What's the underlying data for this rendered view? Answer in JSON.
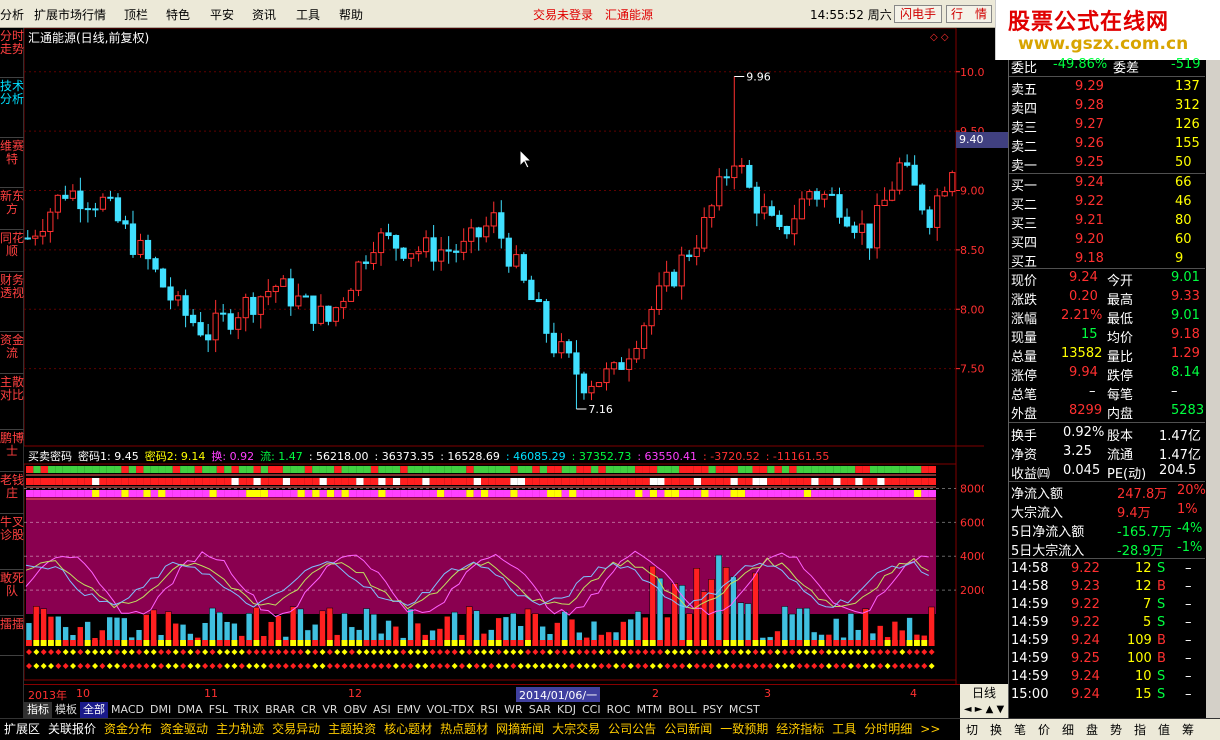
{
  "menu": {
    "items": [
      "分析",
      "扩展市场行情",
      "顶栏",
      "特色",
      "平安",
      "资讯",
      "工具",
      "帮助"
    ],
    "status1": "交易未登录",
    "status2": "汇通能源",
    "clock": "14:55:52 周六",
    "btn1": "闪电手",
    "btn2": "行　情"
  },
  "logo": {
    "main": "股票公式在线网",
    "url": "www.gszx.com.cn"
  },
  "left_tabs": [
    "分时走势",
    "技术分析",
    "维赛特",
    "新东方",
    "同花顺",
    "财务透视",
    "资金流",
    "主散对比",
    "鹏博士",
    "老钱庄",
    "牛叉诊股",
    "敢死队",
    "擂擂"
  ],
  "chart": {
    "title": "汇通能源(日线,前复权)",
    "high_label": "9.96",
    "low_label": "7.16",
    "current_tag": "9.40",
    "price_axis": [
      "10.00",
      "9.50",
      "9.00",
      "8.50",
      "8.00",
      "7.50"
    ],
    "vol_axis": [
      "80000",
      "60000",
      "40000",
      "20000"
    ]
  },
  "indicator": {
    "name": "买卖密码",
    "items": [
      {
        "t": "密码1: 9.45",
        "c": "#ffffff"
      },
      {
        "t": "密码2: 9.14",
        "c": "#ffff00"
      },
      {
        "t": "换: 0.92",
        "c": "#ff40ff"
      },
      {
        "t": "流: 1.47",
        "c": "#00ff40"
      },
      {
        "t": ": 56218.00",
        "c": "#ffffff"
      },
      {
        "t": ": 36373.35",
        "c": "#ffffff"
      },
      {
        "t": ": 16528.69",
        "c": "#ffffff"
      },
      {
        "t": ": 46085.29",
        "c": "#00e0ff"
      },
      {
        "t": ": 37352.73",
        "c": "#00ff40"
      },
      {
        "t": ": 63550.41",
        "c": "#ff40ff"
      },
      {
        "t": ": -3720.52",
        "c": "#ff3030"
      },
      {
        "t": ": -11161.55",
        "c": "#ff3030"
      }
    ]
  },
  "time_axis": {
    "items": [
      "2013年",
      "10",
      "11",
      "12",
      "2014/01/06/一",
      "2",
      "3",
      "4"
    ],
    "period": "日线"
  },
  "indicator_tabs": [
    "指标",
    "模板",
    "全部",
    "MACD",
    "DMI",
    "DMA",
    "FSL",
    "TRIX",
    "BRAR",
    "CR",
    "VR",
    "OBV",
    "ASI",
    "EMV",
    "VOL-TDX",
    "RSI",
    "WR",
    "SAR",
    "KDJ",
    "CCI",
    "ROC",
    "MTM",
    "BOLL",
    "PSY",
    "MCST"
  ],
  "bottom_tabs": [
    "扩展区",
    "关联报价",
    "资金分布",
    "资金驱动",
    "主力轨迹",
    "交易异动",
    "主题投资",
    "核心题材",
    "热点题材",
    "网摘新闻",
    "大宗交易",
    "公司公告",
    "公司新闻",
    "一致预期",
    "经济指标",
    "工具",
    "分时明细",
    ">>"
  ],
  "bottom_right": [
    "切",
    "换",
    "笔",
    "价",
    "细",
    "盘",
    "势",
    "指",
    "值",
    "筹"
  ],
  "quote": {
    "weibi": {
      "label": "委比",
      "value": "-49.86%",
      "label2": "委差",
      "value2": "-519"
    },
    "asks": [
      {
        "label": "卖五",
        "price": "9.29",
        "vol": "137"
      },
      {
        "label": "卖四",
        "price": "9.28",
        "vol": "312"
      },
      {
        "label": "卖三",
        "price": "9.27",
        "vol": "126"
      },
      {
        "label": "卖二",
        "price": "9.26",
        "vol": "155"
      },
      {
        "label": "卖一",
        "price": "9.25",
        "vol": "50"
      }
    ],
    "bids": [
      {
        "label": "买一",
        "price": "9.24",
        "vol": "66"
      },
      {
        "label": "买二",
        "price": "9.22",
        "vol": "46"
      },
      {
        "label": "买三",
        "price": "9.21",
        "vol": "80"
      },
      {
        "label": "买四",
        "price": "9.20",
        "vol": "60"
      },
      {
        "label": "买五",
        "price": "9.18",
        "vol": "9"
      }
    ],
    "stats": [
      {
        "l1": "现价",
        "v1": "9.24",
        "c1": "red",
        "l2": "今开",
        "v2": "9.01",
        "c2": "grn"
      },
      {
        "l1": "涨跌",
        "v1": "0.20",
        "c1": "red",
        "l2": "最高",
        "v2": "9.33",
        "c2": "red"
      },
      {
        "l1": "涨幅",
        "v1": "2.21%",
        "c1": "red",
        "l2": "最低",
        "v2": "9.01",
        "c2": "grn"
      },
      {
        "l1": "现量",
        "v1": "15",
        "c1": "grn",
        "l2": "均价",
        "v2": "9.18",
        "c2": "red"
      },
      {
        "l1": "总量",
        "v1": "13582",
        "c1": "yel",
        "l2": "量比",
        "v2": "1.29",
        "c2": "red"
      },
      {
        "l1": "涨停",
        "v1": "9.94",
        "c1": "red",
        "l2": "跌停",
        "v2": "8.14",
        "c2": "grn"
      },
      {
        "l1": "总笔",
        "v1": "–",
        "c1": "wht",
        "l2": "每笔",
        "v2": "–",
        "c2": "wht"
      },
      {
        "l1": "外盘",
        "v1": "8299",
        "c1": "red",
        "l2": "内盘",
        "v2": "5283",
        "c2": "grn"
      }
    ],
    "fin": [
      {
        "l1": "换手",
        "v1": "0.92%",
        "l2": "股本",
        "v2": "1.47亿"
      },
      {
        "l1": "净资",
        "v1": "3.25",
        "l2": "流通",
        "v2": "1.47亿"
      },
      {
        "l1": "收益㈣",
        "v1": "0.045",
        "l2": "PE(动)",
        "v2": "204.5"
      }
    ],
    "flow": [
      {
        "l": "净流入额",
        "v": "247.8万",
        "p": "20%",
        "c": "red"
      },
      {
        "l": "大宗流入",
        "v": "9.4万",
        "p": "1%",
        "c": "red"
      },
      {
        "l": "5日净流入额",
        "v": "-165.7万",
        "p": "-4%",
        "c": "grn"
      },
      {
        "l": "5日大宗流入",
        "v": "-28.9万",
        "p": "-1%",
        "c": "grn"
      }
    ],
    "ticks": [
      {
        "t": "14:58",
        "p": "9.22",
        "v": "12",
        "s": "S"
      },
      {
        "t": "14:58",
        "p": "9.23",
        "v": "12",
        "s": "B"
      },
      {
        "t": "14:59",
        "p": "9.22",
        "v": "7",
        "s": "S"
      },
      {
        "t": "14:59",
        "p": "9.22",
        "v": "5",
        "s": "S"
      },
      {
        "t": "14:59",
        "p": "9.24",
        "v": "109",
        "s": "B"
      },
      {
        "t": "14:59",
        "p": "9.25",
        "v": "100",
        "s": "B"
      },
      {
        "t": "14:59",
        "p": "9.24",
        "v": "10",
        "s": "S"
      },
      {
        "t": "15:00",
        "p": "9.24",
        "v": "15",
        "s": "S"
      }
    ]
  },
  "chart_data": {
    "type": "candlestick",
    "series_count": 124,
    "ylim": [
      7.0,
      10.2
    ],
    "high": 9.96,
    "low": 7.16,
    "last": 9.24
  }
}
